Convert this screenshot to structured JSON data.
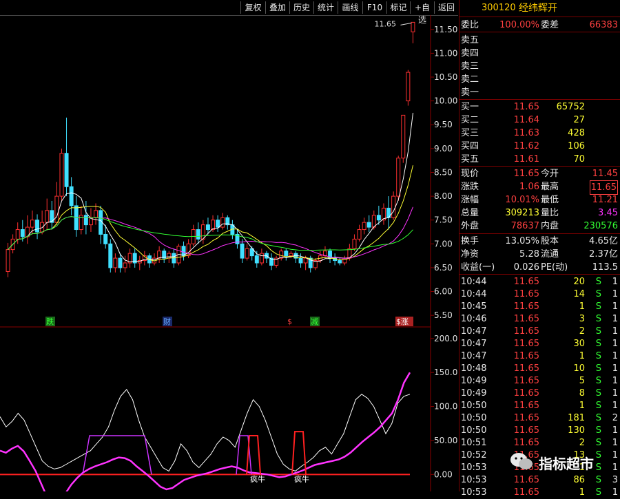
{
  "toolbar": {
    "buttons": [
      "复权",
      "叠加",
      "历史",
      "统计",
      "画线",
      "F10",
      "标记",
      "+自选",
      "返回"
    ]
  },
  "main_chart": {
    "y_ticks": [
      "11.50",
      "11.00",
      "10.50",
      "10.00",
      "9.50",
      "9.00",
      "8.50",
      "8.00",
      "7.50",
      "7.00",
      "6.50",
      "6.00",
      "5.50"
    ],
    "price_label": "11.65",
    "events": [
      {
        "label": "跌",
        "color": "#33ff33",
        "bg": "#1a6a1a"
      },
      {
        "label": "财",
        "color": "#66aaff",
        "bg": "#1a2a6a"
      },
      {
        "label": "$",
        "color": "#ff4040",
        "bg": "#000000"
      },
      {
        "label": "减",
        "color": "#33ff33",
        "bg": "#1a6a1a"
      },
      {
        "label": "$涨",
        "color": "#ffffff",
        "bg": "#aa2222"
      }
    ]
  },
  "sub_chart": {
    "y_ticks": [
      "200.00",
      "150.00",
      "100.00",
      "50.00",
      "0.00"
    ],
    "signals": [
      "疯牛",
      "疯牛"
    ]
  },
  "quote": {
    "code": "300120",
    "name": "经纬辉开",
    "weibi_label": "委比",
    "weibi_value": "100.00%",
    "weicha_label": "委差",
    "weicha_value": "66383",
    "asks": [
      {
        "label": "卖五",
        "price": "",
        "vol": ""
      },
      {
        "label": "卖四",
        "price": "",
        "vol": ""
      },
      {
        "label": "卖三",
        "price": "",
        "vol": ""
      },
      {
        "label": "卖二",
        "price": "",
        "vol": ""
      },
      {
        "label": "卖一",
        "price": "",
        "vol": ""
      }
    ],
    "bids": [
      {
        "label": "买一",
        "price": "11.65",
        "vol": "65752"
      },
      {
        "label": "买二",
        "price": "11.64",
        "vol": "27"
      },
      {
        "label": "买三",
        "price": "11.63",
        "vol": "428"
      },
      {
        "label": "买四",
        "price": "11.62",
        "vol": "106"
      },
      {
        "label": "买五",
        "price": "11.61",
        "vol": "70"
      }
    ],
    "stats": [
      {
        "l1": "现价",
        "v1": "11.65",
        "c1": "red",
        "l2": "今开",
        "v2": "11.45",
        "c2": "red"
      },
      {
        "l1": "涨跌",
        "v1": "1.06",
        "c1": "red",
        "l2": "最高",
        "v2": "11.65",
        "c2": "red"
      },
      {
        "l1": "涨幅",
        "v1": "10.01%",
        "c1": "red",
        "l2": "最低",
        "v2": "11.21",
        "c2": "red"
      },
      {
        "l1": "总量",
        "v1": "309213",
        "c1": "yel",
        "l2": "量比",
        "v2": "3.45",
        "c2": "mag"
      },
      {
        "l1": "外盘",
        "v1": "78637",
        "c1": "red",
        "l2": "内盘",
        "v2": "230576",
        "c2": "grn"
      }
    ],
    "stats2": [
      {
        "l1": "换手",
        "v1": "13.05%",
        "l2": "股本",
        "v2": "4.65亿"
      },
      {
        "l1": "净资",
        "v1": "5.28",
        "l2": "流通",
        "v2": "2.37亿"
      },
      {
        "l1": "收益(一)",
        "v1": "0.026",
        "l2": "PE(动)",
        "v2": "113.5"
      }
    ],
    "ticks": [
      {
        "time": "10:44",
        "price": "11.65",
        "vol": "20",
        "side": "S",
        "n": "1"
      },
      {
        "time": "10:44",
        "price": "11.65",
        "vol": "14",
        "side": "S",
        "n": "1"
      },
      {
        "time": "10:45",
        "price": "11.65",
        "vol": "1",
        "side": "S",
        "n": "1"
      },
      {
        "time": "10:46",
        "price": "11.65",
        "vol": "3",
        "side": "S",
        "n": "1"
      },
      {
        "time": "10:47",
        "price": "11.65",
        "vol": "2",
        "side": "S",
        "n": "1"
      },
      {
        "time": "10:47",
        "price": "11.65",
        "vol": "30",
        "side": "S",
        "n": "1"
      },
      {
        "time": "10:47",
        "price": "11.65",
        "vol": "1",
        "side": "S",
        "n": "1"
      },
      {
        "time": "10:48",
        "price": "11.65",
        "vol": "10",
        "side": "S",
        "n": "1"
      },
      {
        "time": "10:49",
        "price": "11.65",
        "vol": "5",
        "side": "S",
        "n": "1"
      },
      {
        "time": "10:49",
        "price": "11.65",
        "vol": "8",
        "side": "S",
        "n": "1"
      },
      {
        "time": "10:50",
        "price": "11.65",
        "vol": "1",
        "side": "S",
        "n": "1"
      },
      {
        "time": "10:50",
        "price": "11.65",
        "vol": "181",
        "side": "S",
        "n": "2"
      },
      {
        "time": "10:50",
        "price": "11.65",
        "vol": "130",
        "side": "S",
        "n": "1"
      },
      {
        "time": "10:51",
        "price": "11.65",
        "vol": "2",
        "side": "S",
        "n": "1"
      },
      {
        "time": "10:52",
        "price": "11.65",
        "vol": "13",
        "side": "S",
        "n": "1"
      },
      {
        "time": "10:53",
        "price": "11.65",
        "vol": "1",
        "side": "S",
        "n": "1"
      },
      {
        "time": "10:53",
        "price": "11.65",
        "vol": "86",
        "side": "S",
        "n": "3"
      },
      {
        "time": "10:53",
        "price": "11.65",
        "vol": "1",
        "side": "S",
        "n": "1"
      }
    ]
  },
  "watermark": {
    "text": "指标超市"
  },
  "chart_data": {
    "type": "candlestick",
    "ylim": [
      5.3,
      11.8
    ],
    "candles": [
      [
        6.42,
        6.88,
        6.3,
        7.02
      ],
      [
        6.88,
        7.1,
        6.8,
        7.2
      ],
      [
        7.1,
        7.3,
        7.0,
        7.45
      ],
      [
        7.3,
        7.15,
        7.05,
        7.5
      ],
      [
        7.15,
        7.35,
        7.0,
        7.6
      ],
      [
        7.35,
        7.5,
        7.2,
        7.7
      ],
      [
        7.5,
        7.25,
        7.1,
        7.62
      ],
      [
        7.25,
        7.45,
        7.2,
        7.7
      ],
      [
        7.45,
        7.7,
        7.3,
        7.95
      ],
      [
        7.7,
        7.45,
        7.3,
        7.9
      ],
      [
        7.45,
        8.0,
        7.4,
        8.3
      ],
      [
        8.0,
        8.9,
        7.9,
        9.0
      ],
      [
        8.9,
        8.2,
        8.0,
        9.65
      ],
      [
        8.2,
        7.8,
        7.6,
        8.4
      ],
      [
        7.8,
        7.3,
        7.15,
        8.0
      ],
      [
        7.3,
        7.6,
        7.2,
        7.8
      ],
      [
        7.6,
        7.4,
        7.2,
        7.9
      ],
      [
        7.4,
        7.55,
        7.25,
        7.75
      ],
      [
        7.55,
        7.7,
        7.4,
        7.85
      ],
      [
        7.7,
        7.2,
        7.0,
        7.8
      ],
      [
        7.2,
        7.0,
        6.9,
        7.4
      ],
      [
        7.0,
        6.5,
        6.4,
        7.1
      ],
      [
        6.5,
        6.7,
        6.4,
        6.8
      ],
      [
        6.7,
        6.5,
        6.4,
        6.8
      ],
      [
        6.5,
        6.6,
        6.4,
        6.75
      ],
      [
        6.6,
        6.8,
        6.5,
        6.9
      ],
      [
        6.8,
        6.6,
        6.5,
        6.9
      ],
      [
        6.6,
        6.65,
        6.45,
        6.75
      ],
      [
        6.65,
        6.75,
        6.55,
        6.85
      ],
      [
        6.75,
        6.6,
        6.5,
        6.8
      ],
      [
        6.6,
        6.7,
        6.55,
        6.8
      ],
      [
        6.7,
        6.85,
        6.6,
        6.95
      ],
      [
        6.85,
        6.7,
        6.6,
        6.9
      ],
      [
        6.7,
        6.8,
        6.6,
        6.85
      ],
      [
        6.8,
        6.6,
        6.5,
        6.9
      ],
      [
        6.6,
        6.95,
        6.55,
        7.0
      ],
      [
        6.95,
        6.75,
        6.65,
        7.05
      ],
      [
        6.75,
        7.0,
        6.7,
        7.1
      ],
      [
        7.0,
        7.3,
        6.95,
        7.4
      ],
      [
        7.3,
        7.1,
        7.0,
        7.45
      ],
      [
        7.1,
        7.4,
        7.0,
        7.5
      ],
      [
        7.4,
        7.3,
        7.2,
        7.55
      ],
      [
        7.3,
        7.5,
        7.25,
        7.6
      ],
      [
        7.5,
        7.35,
        7.25,
        7.6
      ],
      [
        7.35,
        7.55,
        7.3,
        7.65
      ],
      [
        7.55,
        7.4,
        7.3,
        7.6
      ],
      [
        7.4,
        7.2,
        7.1,
        7.5
      ],
      [
        7.2,
        7.0,
        6.9,
        7.3
      ],
      [
        7.0,
        6.7,
        6.6,
        7.1
      ],
      [
        6.7,
        6.9,
        6.65,
        7.0
      ],
      [
        6.9,
        6.75,
        6.65,
        6.95
      ],
      [
        6.75,
        6.6,
        6.5,
        6.85
      ],
      [
        6.6,
        6.8,
        6.55,
        6.9
      ],
      [
        6.8,
        6.7,
        6.6,
        6.85
      ],
      [
        6.7,
        6.55,
        6.45,
        6.8
      ],
      [
        6.55,
        6.7,
        6.5,
        6.75
      ],
      [
        6.7,
        6.85,
        6.65,
        6.9
      ],
      [
        6.85,
        6.75,
        6.65,
        6.9
      ],
      [
        6.75,
        6.8,
        6.7,
        6.85
      ],
      [
        6.8,
        6.7,
        6.6,
        6.85
      ],
      [
        6.7,
        6.6,
        6.5,
        6.8
      ],
      [
        6.6,
        6.7,
        6.45,
        6.75
      ],
      [
        6.7,
        6.5,
        6.4,
        6.75
      ],
      [
        6.5,
        6.65,
        6.45,
        6.7
      ],
      [
        6.65,
        6.75,
        6.6,
        6.85
      ],
      [
        6.75,
        6.85,
        6.7,
        6.95
      ],
      [
        6.85,
        6.7,
        6.6,
        6.9
      ],
      [
        6.7,
        6.65,
        6.55,
        6.8
      ],
      [
        6.65,
        6.6,
        6.55,
        6.7
      ],
      [
        6.6,
        6.7,
        6.55,
        6.75
      ],
      [
        6.7,
        6.9,
        6.65,
        7.0
      ],
      [
        6.9,
        7.1,
        6.85,
        7.2
      ],
      [
        7.1,
        7.3,
        7.05,
        7.4
      ],
      [
        7.3,
        7.45,
        7.2,
        7.55
      ],
      [
        7.45,
        7.35,
        7.25,
        7.6
      ],
      [
        7.35,
        7.6,
        7.3,
        7.7
      ],
      [
        7.6,
        7.5,
        7.4,
        7.8
      ],
      [
        7.5,
        7.75,
        7.4,
        7.85
      ],
      [
        7.75,
        7.55,
        7.3,
        8.0
      ],
      [
        7.55,
        8.0,
        7.5,
        8.1
      ],
      [
        8.0,
        8.8,
        7.9,
        8.85
      ],
      [
        8.8,
        9.7,
        8.7,
        9.7
      ],
      [
        10.0,
        10.6,
        9.9,
        10.65
      ],
      [
        11.45,
        11.65,
        11.21,
        11.65
      ]
    ]
  }
}
